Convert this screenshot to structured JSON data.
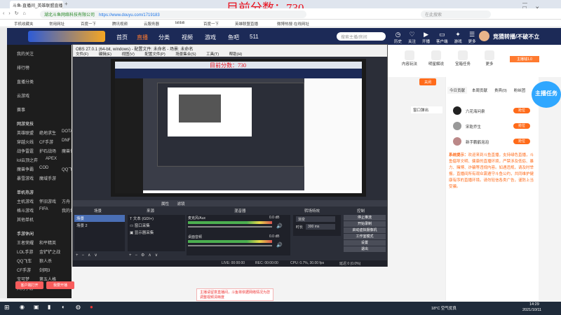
{
  "browser": {
    "tab_title": "斗鱼-直播间_英雄联盟直播_火热主播",
    "url": "https://www.douyu.com/1719183",
    "secure_text": "湖北斗鱼网络科技有限公司",
    "right_text": "在此搜索",
    "bookmarks": [
      "手机收藏夹",
      "常用网址",
      "百度一下",
      "腾讯视频",
      "云服务器",
      "bilibili",
      "百度一下",
      "英雄联盟直播",
      "微博热搜·在线网址"
    ]
  },
  "overlay_score": "目前分数：730",
  "header": {
    "nav": [
      "首页",
      "直播",
      "分类",
      "视频",
      "游戏",
      "鱼吧",
      "511"
    ],
    "search_placeholder": "搜索主播/房间",
    "icons": [
      "历史",
      "关注",
      "开播",
      "客户端",
      "游戏",
      "更多"
    ],
    "badge": "竞猜转播/不破不立"
  },
  "sidebar": {
    "top": [
      "我的关注",
      "排行榜",
      "直播分类",
      "云游戏",
      "赛事"
    ],
    "sections": [
      {
        "title": "网游竞技",
        "items": [
          "英雄联盟",
          "绝地求生",
          "DOTA2",
          "穿越火线",
          "CF手游",
          "DNF",
          "战争雷霆",
          "护石战场",
          "魔兽世界",
          "lol云顶之弈",
          "APEX",
          "魔兽争霸",
          "COD",
          "QQ飞车",
          "暴雪游戏",
          "魔域手游"
        ]
      },
      {
        "title": "单机热游",
        "items": [
          "主机游戏",
          "怀旧游戏",
          "方舟",
          "格斗游戏",
          "FIFA",
          "我的世界",
          "其他单机"
        ]
      },
      {
        "title": "手游休闲",
        "items": [
          "王者荣耀",
          "和平精英",
          "LOL手游",
          "金铲铲之战",
          "QQ飞车",
          "狼人杀",
          "CF手游",
          "剑网3",
          "宝可梦",
          "第五人格",
          "天刀手游"
        ]
      }
    ],
    "bottom_buttons": [
      "客户端打开",
      "我要开播"
    ]
  },
  "right_panel": {
    "top_icons": [
      "内容玩法",
      "明星解说",
      "宝箱任务",
      "更多"
    ],
    "ad_badge": "主播钱1.0",
    "tabs": [
      "今日贡献",
      "本周贡献",
      "贵宾(0)",
      "粉丝团"
    ],
    "ranks": [
      {
        "name": "六花海问泉",
        "btn": "抢位"
      },
      {
        "name": "宋乾乔生",
        "btn": "抢位"
      },
      {
        "name": "新手鹏鹤泡泡",
        "btn": "抢位"
      }
    ],
    "notice_title": "系统提示：",
    "notice_text": "欢迎来到斗鱼直播，支持绿色直播，斗鱼倡导文明、健康的直播环境，严禁涉及低俗、暴力、赌博、诈骗等违规内容。如遇违规，请及时举报。直播间所有观众需遵守斗鱼公约，共同维护健康有序的直播环境。请勿轻信各类广告，谨防上当受骗。",
    "float_title": "主播任务"
  },
  "obs": {
    "title": "OBS 27.0.1 (64-bit, windows) - 配置文件: 未命名 - 场景: 未命名",
    "menu": [
      "文件(F)",
      "编辑(E)",
      "视图(V)",
      "配置文件(P)",
      "场景集合(S)",
      "工具(T)",
      "帮助(H)"
    ],
    "inner_score": "目前分数：730",
    "source_buttons": [
      "属性",
      "滤镜"
    ],
    "panels": {
      "scenes": {
        "title": "场景",
        "items": [
          "场景",
          "场景 2"
        ]
      },
      "sources": {
        "title": "来源",
        "items": [
          "文本 (GDI+)",
          "窗口采集",
          "显示器采集"
        ]
      },
      "mixer": {
        "title": "混音器",
        "channels": [
          {
            "name": "麦克风/Aux",
            "db": "0.0 dB"
          },
          {
            "name": "桌面音频",
            "db": "0.0 dB"
          }
        ]
      },
      "transitions": {
        "title": "转场特效",
        "type": "渐变",
        "duration_label": "时长",
        "duration_value": "300 ms"
      },
      "controls": {
        "title": "控制",
        "buttons": [
          "停止推流",
          "开始录制",
          "启动虚拟摄像机",
          "工作室模式",
          "设置",
          "退出"
        ]
      }
    },
    "status": {
      "live": "LIVE: 00:00:00",
      "rec": "REC: 00:00:00",
      "cpu": "CPU: 0.7%, 30.00 fps",
      "dropped": "延迟 0 (0.0%)"
    }
  },
  "toast": "主播请留意直播间，斗鱼将依据网络情况为您调整视频清晰度",
  "taskbar": {
    "weather": "18°C 空气优良",
    "time": "14:29",
    "date": "2021/10/11"
  }
}
